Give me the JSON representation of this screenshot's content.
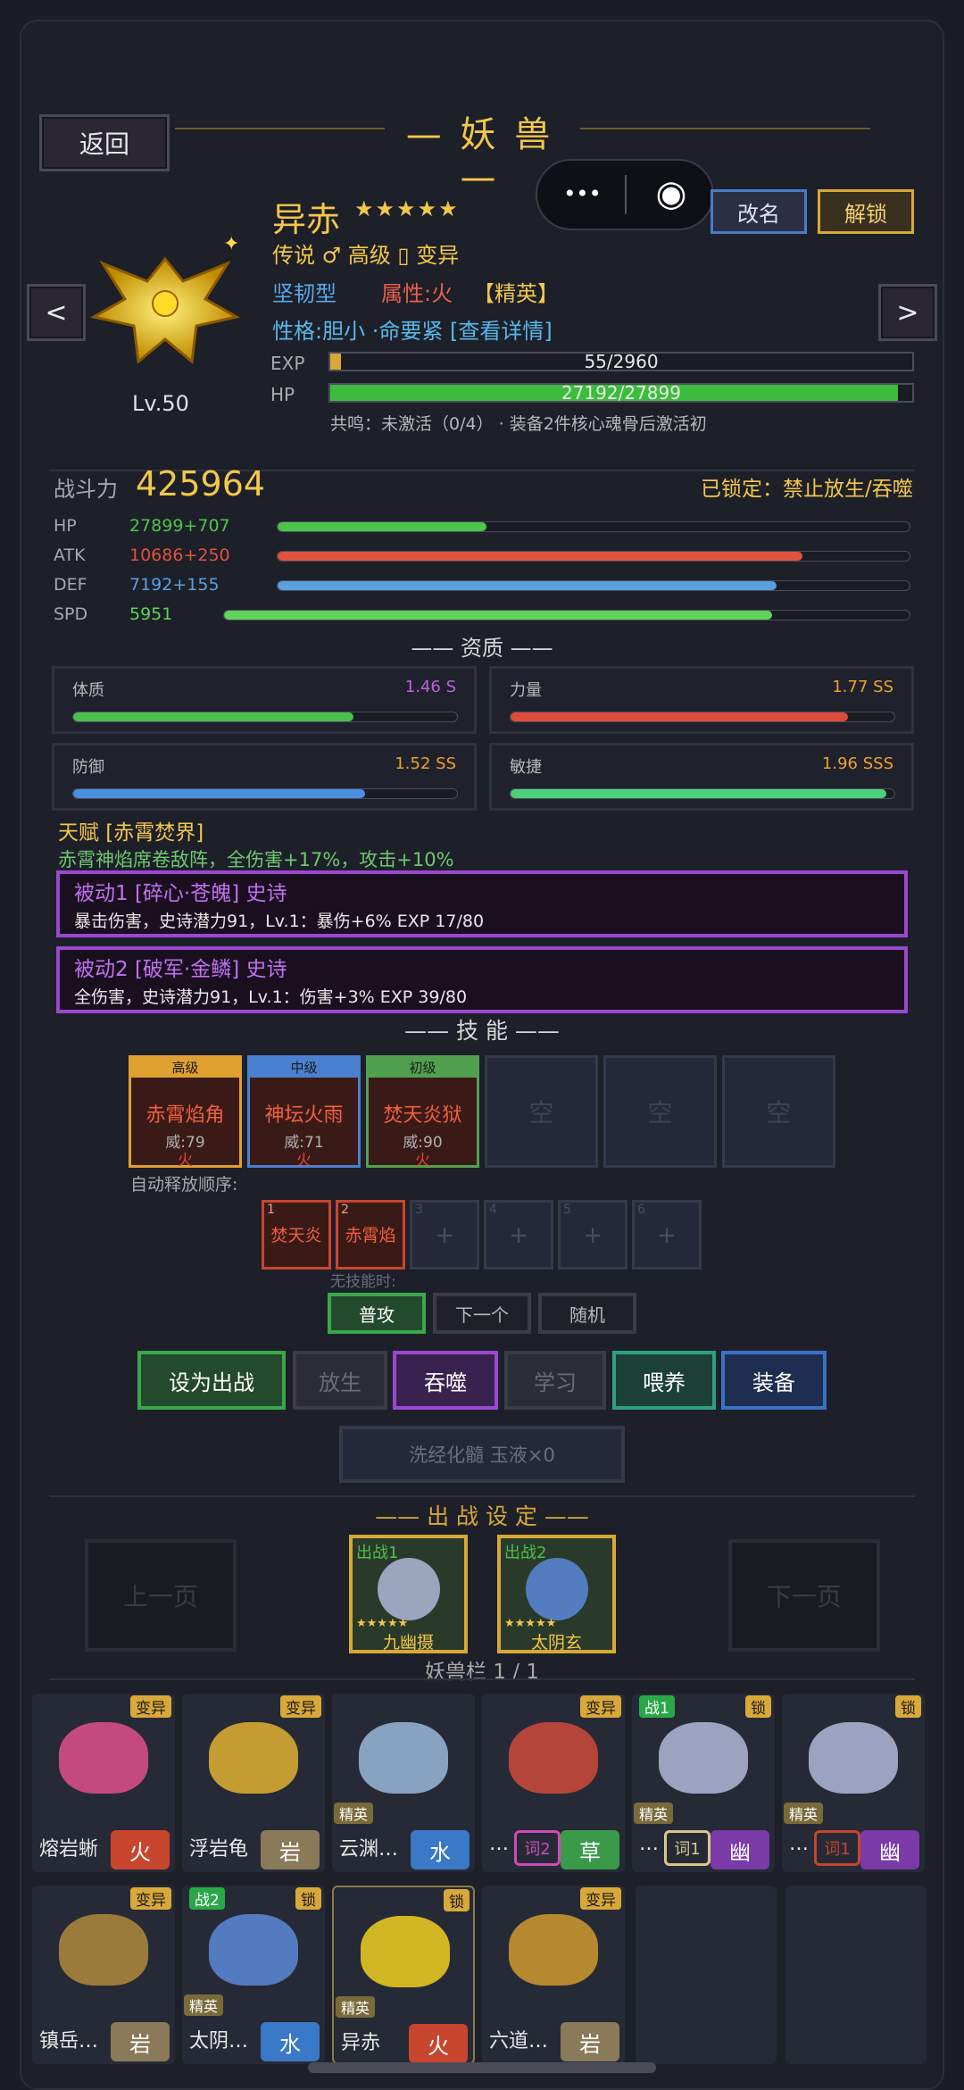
{
  "header": {
    "back": "返回",
    "title": "— 妖 兽 —"
  },
  "capsule": {
    "more": "•••",
    "target": "◉"
  },
  "actions": {
    "rename": "改名",
    "unlock": "解锁"
  },
  "nav": {
    "prev": "<",
    "next": ">"
  },
  "pet": {
    "name": "异赤",
    "stars": "★★★★★",
    "line1": "传说 ♂ 高级 ▯ 变异",
    "type": "坚韧型",
    "attr": "属性:火",
    "elite": "【精英】",
    "personality": "性格:胆小 ·命要紧 [查看详情]",
    "level": "Lv.50",
    "exp_label": "EXP",
    "exp_text": "55/2960",
    "exp_fraction": 0.019,
    "hp_label": "HP",
    "hp_text": "27192/27899",
    "hp_fraction": 0.975,
    "resonance": "共鸣：未激活（0/4） · 装备2件核心魂骨后激活初"
  },
  "power": {
    "label": "战斗力",
    "value": "425964",
    "locked": "已锁定：禁止放生/吞噬"
  },
  "stats": [
    {
      "name": "HP",
      "value": "27899+707",
      "color": "#4fc54a",
      "fraction": 0.33
    },
    {
      "name": "ATK",
      "value": "10686+250",
      "color": "#e0523c",
      "fraction": 0.83
    },
    {
      "name": "DEF",
      "value": "7192+155",
      "color": "#5aa0e0",
      "fraction": 0.79
    },
    {
      "name": "SPD",
      "value": "5951",
      "color": "#5fd35a",
      "fraction": 0.8
    }
  ],
  "aptitude": {
    "title": "—— 资质 ——",
    "items": [
      {
        "name": "体质",
        "value": "1.46 S",
        "valcolor": "#c060e0",
        "color": "#4cc04c",
        "fraction": 0.73
      },
      {
        "name": "力量",
        "value": "1.77 SS",
        "valcolor": "#f0a030",
        "color": "#e04a3a",
        "fraction": 0.88
      },
      {
        "name": "防御",
        "value": "1.52 SS",
        "valcolor": "#f0a030",
        "color": "#4a90e0",
        "fraction": 0.76
      },
      {
        "name": "敏捷",
        "value": "1.96 SSS",
        "valcolor": "#f0a030",
        "color": "#4cd07a",
        "fraction": 0.98
      }
    ]
  },
  "talent": {
    "title": "天赋 [赤霄焚界]",
    "desc": "赤霄神焰席卷敌阵，全伤害+17%，攻击+10%"
  },
  "passives": [
    {
      "title": "被动1 [碎心·苍魄] 史诗",
      "desc": "暴击伤害，史诗潜力91，Lv.1：暴伤+6%  EXP 17/80"
    },
    {
      "title": "被动2 [破军·金鳞] 史诗",
      "desc": "全伤害，史诗潜力91，Lv.1：伤害+3%  EXP 39/80"
    }
  ],
  "skills": {
    "title": "—— 技 能 ——",
    "items": [
      {
        "grade": "高级",
        "name": "赤霄焰角",
        "power": "威:79",
        "elem": "火",
        "border": "#e0a030"
      },
      {
        "grade": "中级",
        "name": "神坛火雨",
        "power": "威:71",
        "elem": "火",
        "border": "#4a80d0"
      },
      {
        "grade": "初级",
        "name": "焚天炎狱",
        "power": "威:90",
        "elem": "火",
        "border": "#50a050"
      }
    ],
    "empty": "空"
  },
  "auto_order": {
    "label": "自动释放顺序:",
    "slots": [
      {
        "num": "1",
        "name": "焚天炎"
      },
      {
        "num": "2",
        "name": "赤霄焰"
      },
      {
        "num": "3",
        "name": "+"
      },
      {
        "num": "4",
        "name": "+"
      },
      {
        "num": "5",
        "name": "+"
      },
      {
        "num": "6",
        "name": "+"
      }
    ],
    "no_skill_label": "无技能时:",
    "modes": [
      "普攻",
      "下一个",
      "随机"
    ]
  },
  "buttons": {
    "set_battle": "设为出战",
    "release": "放生",
    "devour": "吞噬",
    "learn": "学习",
    "feed": "喂养",
    "equip": "装备",
    "wash": "洗经化髓  玉液×0"
  },
  "battle": {
    "title": "—— 出 战 设 定 ——",
    "prev": "上一页",
    "next": "下一页",
    "slots": [
      {
        "tag": "出战1",
        "stars": "★★★★★",
        "name": "九幽摄"
      },
      {
        "tag": "出战2",
        "stars": "★★★★★",
        "name": "太阴玄"
      }
    ],
    "bar_label": "妖兽栏 1 / 1"
  },
  "roster": [
    {
      "name": "熔岩蜥",
      "top": "变异",
      "elem": "火",
      "ecolor": "#c8452e",
      "badge": "",
      "word": "",
      "battle": "",
      "art": "#e0508a"
    },
    {
      "name": "浮岩龟",
      "top": "变异",
      "elem": "岩",
      "ecolor": "#8a7a5a",
      "badge": "",
      "word": "",
      "battle": "",
      "art": "#e0b030"
    },
    {
      "name": "云渊…",
      "top": "",
      "elem": "水",
      "ecolor": "#3a78c8",
      "badge": "精英",
      "word": "",
      "battle": "",
      "art": "#9ab8d8"
    },
    {
      "name": "…",
      "top": "变异",
      "elem": "草",
      "ecolor": "#3a9a4a",
      "badge": "",
      "word": "词2",
      "battle": "",
      "art": "#d04a3a"
    },
    {
      "name": "…",
      "top": "锁",
      "elem": "幽",
      "ecolor": "#7a3aa8",
      "badge": "精英",
      "word": "词1",
      "battle": "战1",
      "art": "#b0b8d8"
    },
    {
      "name": "…",
      "top": "锁",
      "elem": "幽",
      "ecolor": "#7a3aa8",
      "badge": "精英",
      "word": "词1",
      "battle": "",
      "art": "#b0b8d8"
    },
    {
      "name": "镇岳…",
      "top": "变异",
      "elem": "岩",
      "ecolor": "#8a7a5a",
      "badge": "",
      "word": "",
      "battle": "",
      "art": "#b08a3a"
    },
    {
      "name": "太阴…",
      "top": "锁",
      "elem": "水",
      "ecolor": "#3a78c8",
      "badge": "精英",
      "word": "",
      "battle": "战2",
      "art": "#5a8ad8"
    },
    {
      "name": "异赤",
      "top": "锁",
      "elem": "火",
      "ecolor": "#c8452e",
      "badge": "精英",
      "word": "",
      "battle": "",
      "art": "#f0d020"
    },
    {
      "name": "六道…",
      "top": "变异",
      "elem": "岩",
      "ecolor": "#8a7a5a",
      "badge": "",
      "word": "",
      "battle": "",
      "art": "#d09a30"
    }
  ]
}
